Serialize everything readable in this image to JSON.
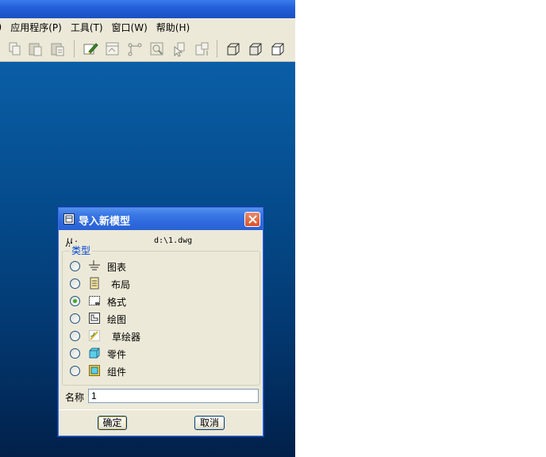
{
  "menubar": {
    "items": [
      {
        "label": "J)"
      },
      {
        "label": "应用程序(P)"
      },
      {
        "label": "工具(T)"
      },
      {
        "label": "窗口(W)"
      },
      {
        "label": "帮助(H)"
      }
    ]
  },
  "toolbar": {
    "buttons": [
      "copy-icon",
      "paste-icon",
      "paste-special-icon",
      "regenerate-icon",
      "sketch-icon",
      "datum-icon",
      "zoom-icon",
      "select-icon",
      "copy-select-icon",
      "view-box-1-icon",
      "view-box-2-icon",
      "view-box-3-icon"
    ]
  },
  "dialog": {
    "title": "导入新模型",
    "from_label": "从:",
    "from_path": "d:\\1.dwg",
    "type_group_label": "类型",
    "options": [
      {
        "label": "图表",
        "icon": "diagram-icon",
        "selected": false
      },
      {
        "label": "布局",
        "icon": "layout-icon",
        "selected": false
      },
      {
        "label": "格式",
        "icon": "format-icon",
        "selected": true
      },
      {
        "label": "绘图",
        "icon": "drawing-icon",
        "selected": false
      },
      {
        "label": "草绘器",
        "icon": "sketcher-icon",
        "selected": false
      },
      {
        "label": "零件",
        "icon": "part-icon",
        "selected": false
      },
      {
        "label": "组件",
        "icon": "assembly-icon",
        "selected": false
      }
    ],
    "name_label": "名称",
    "name_value": "1",
    "ok_label": "确定",
    "cancel_label": "取消"
  },
  "colors": {
    "titlebar": "#2460d8",
    "chrome": "#ece9d8",
    "canvas_top": "#0a5ea6",
    "canvas_bottom": "#02204a",
    "group_label": "#0046d5",
    "radio_dot": "#3fa82b"
  }
}
